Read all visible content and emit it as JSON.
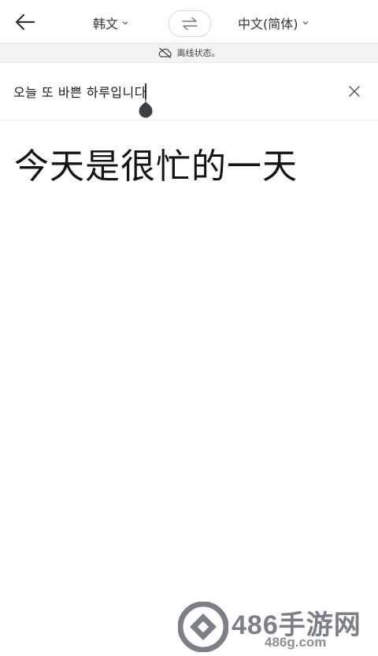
{
  "header": {
    "source_language": "韩文",
    "target_language": "中文(简体)"
  },
  "status": {
    "offline_text": "离线状态。"
  },
  "input": {
    "source_text": "오늘 또 바쁜 하루입니다"
  },
  "output": {
    "translation": "今天是很忙的一天"
  },
  "watermark": {
    "title": "486手游网",
    "url": "486g.com"
  },
  "icons": {
    "back": "arrow-left-icon",
    "swap": "swap-arrows-icon",
    "offline": "cloud-off-icon",
    "clear": "close-icon"
  },
  "colors": {
    "background": "#ffffff",
    "status_bar": "#f1f3f5",
    "text": "#1c1c1c",
    "watermark": "#7b7f86"
  }
}
